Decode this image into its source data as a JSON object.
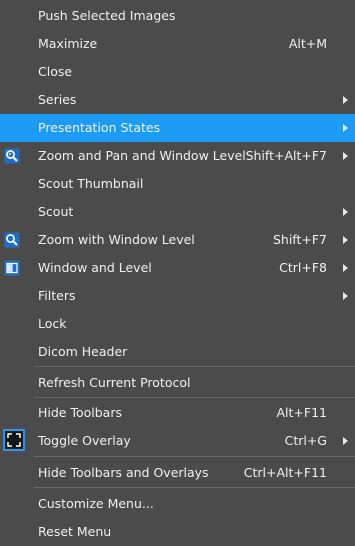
{
  "menu": {
    "items": [
      {
        "label": "Push Selected Images",
        "shortcut": ""
      },
      {
        "label": "Maximize",
        "shortcut": "Alt+M"
      },
      {
        "label": "Close",
        "shortcut": ""
      },
      {
        "label": "Series",
        "shortcut": ""
      },
      {
        "label": "Presentation States",
        "shortcut": ""
      },
      {
        "label": "Zoom and Pan and Window Level",
        "shortcut": "Shift+Alt+F7"
      },
      {
        "label": "Scout Thumbnail",
        "shortcut": ""
      },
      {
        "label": "Scout",
        "shortcut": ""
      },
      {
        "label": "Zoom with Window Level",
        "shortcut": "Shift+F7"
      },
      {
        "label": "Window and Level",
        "shortcut": "Ctrl+F8"
      },
      {
        "label": "Filters",
        "shortcut": ""
      },
      {
        "label": "Lock",
        "shortcut": ""
      },
      {
        "label": "Dicom Header",
        "shortcut": ""
      },
      {
        "label": "Refresh Current Protocol",
        "shortcut": ""
      },
      {
        "label": "Hide Toolbars",
        "shortcut": "Alt+F11"
      },
      {
        "label": "Toggle Overlay",
        "shortcut": "Ctrl+G"
      },
      {
        "label": "Hide Toolbars and Overlays",
        "shortcut": "Ctrl+Alt+F11"
      },
      {
        "label": "Customize Menu...",
        "shortcut": ""
      },
      {
        "label": "Reset Menu",
        "shortcut": ""
      }
    ],
    "highlighted_item": "Presentation States",
    "colors": {
      "background": "#4b4b4b",
      "highlight": "#1b9cf2",
      "text": "#f0f0f0",
      "separator": "#676767"
    }
  }
}
